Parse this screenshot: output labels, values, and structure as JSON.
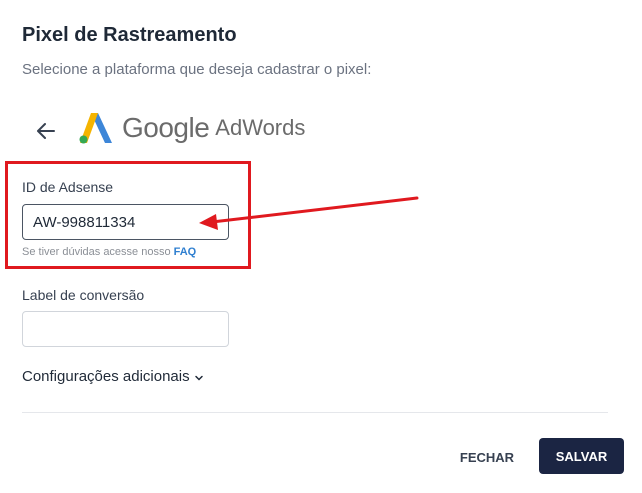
{
  "header": {
    "title": "Pixel de Rastreamento",
    "subtitle": "Selecione a plataforma que deseja cadastrar o pixel:"
  },
  "platform": {
    "logo_google": "Google",
    "logo_adwords": "AdWords",
    "back_icon": "arrow-left-icon"
  },
  "form": {
    "adsense_id": {
      "label": "ID de Adsense",
      "value": "AW-998811334",
      "hint_text": "Se tiver dúvidas acesse nosso",
      "hint_link": "FAQ"
    },
    "conversion_label": {
      "label": "Label de conversão",
      "value": ""
    },
    "advanced_toggle": "Configurações adicionais",
    "advanced_icon": "chevron-down-icon"
  },
  "actions": {
    "close_label": "FECHAR",
    "save_label": "SALVAR"
  },
  "colors": {
    "highlight": "#e0191f",
    "primary_button": "#1b2543",
    "link": "#2f7fd0"
  }
}
